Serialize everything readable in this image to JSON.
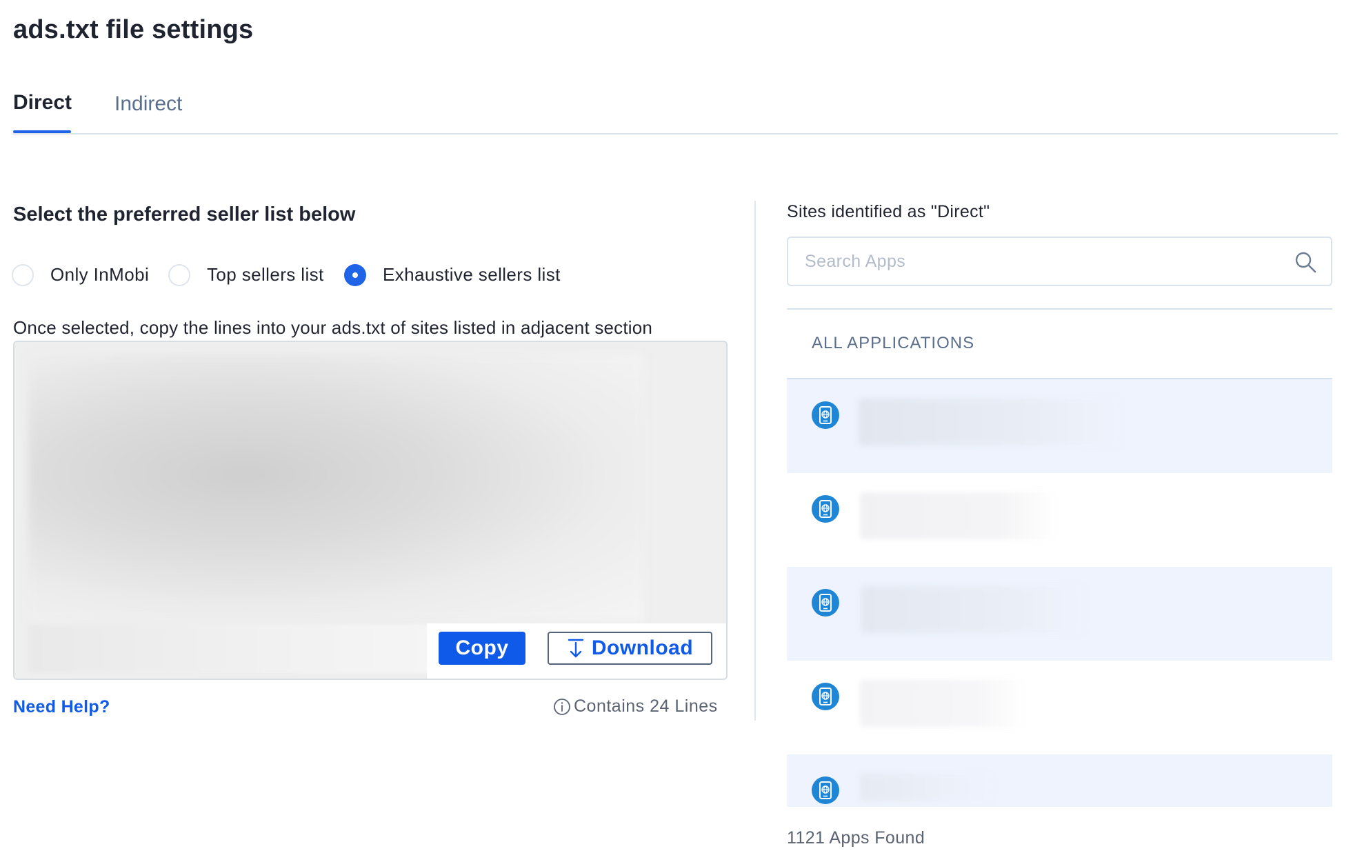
{
  "page": {
    "title": "ads.txt file settings"
  },
  "tabs": [
    {
      "label": "Direct",
      "active": true
    },
    {
      "label": "Indirect",
      "active": false
    }
  ],
  "seller": {
    "heading": "Select the preferred seller list below",
    "options": [
      {
        "label": "Only InMobi",
        "checked": false
      },
      {
        "label": "Top sellers list",
        "checked": false
      },
      {
        "label": "Exhaustive sellers list",
        "checked": true
      }
    ],
    "instruction": "Once selected, copy the lines into your ads.txt of sites listed in adjacent section",
    "copy_label": "Copy",
    "download_label": "Download",
    "help_label": "Need Help?",
    "lines_info": "Contains 24 Lines"
  },
  "sites": {
    "title": "Sites identified as \"Direct\"",
    "search_placeholder": "Search Apps",
    "list_header": "ALL APPLICATIONS",
    "apps_count": "1121 Apps Found",
    "icon": "mobile-web-app-icon"
  },
  "colors": {
    "accent": "#0f5ae8",
    "row_highlight": "#eef3fd",
    "app_icon": "#1f86d6"
  }
}
